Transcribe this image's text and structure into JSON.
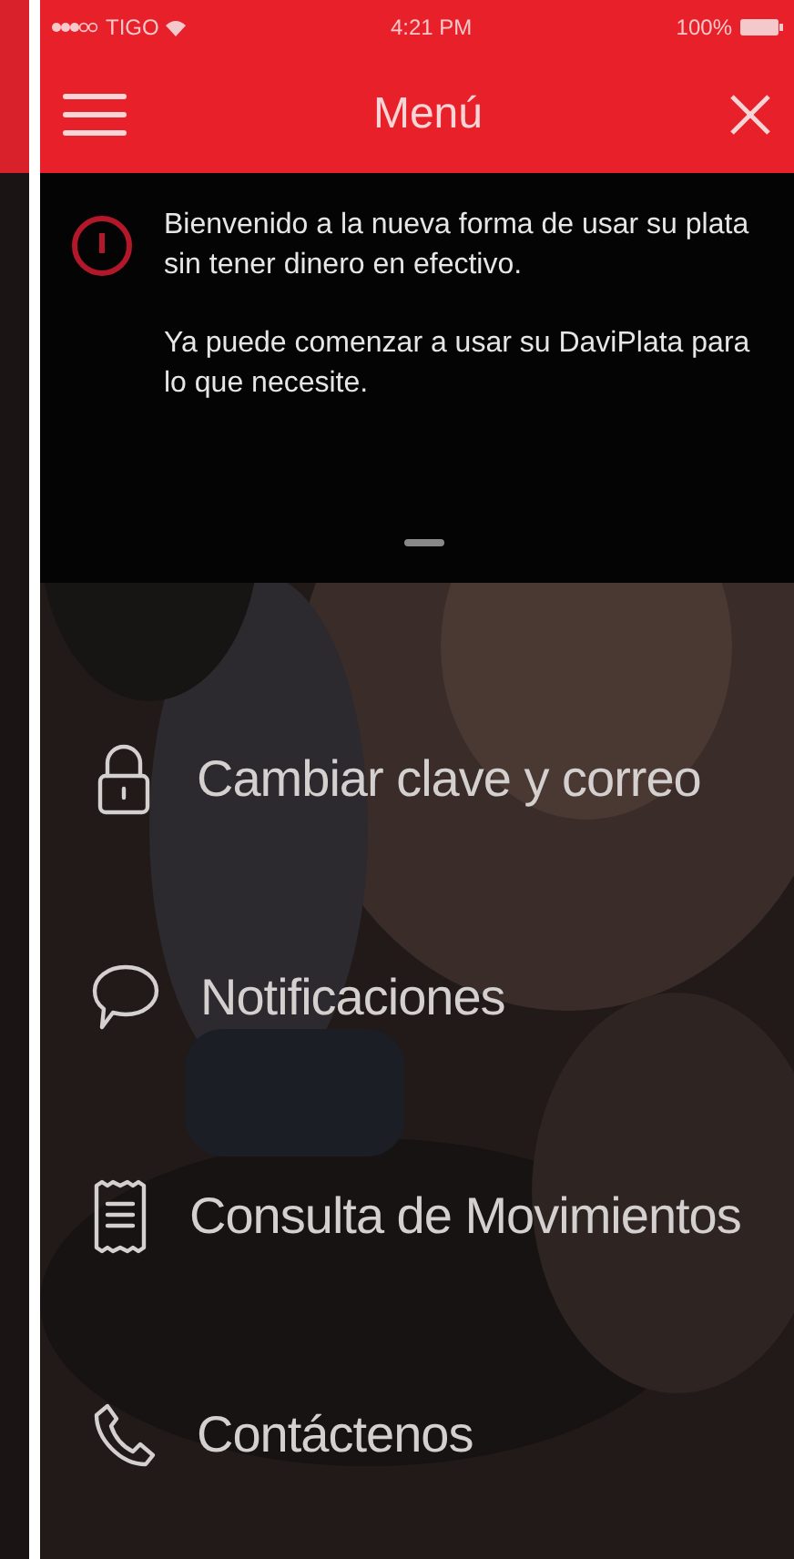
{
  "status_bar": {
    "carrier": "TIGO",
    "time": "4:21 PM",
    "battery": "100%"
  },
  "header": {
    "title": "Menú"
  },
  "welcome_overlay": {
    "paragraphs": [
      "Bienvenido a la nueva forma de usar su plata sin tener dinero en efectivo.",
      "Ya puede comenzar a usar su DaviPlata para lo que necesite."
    ]
  },
  "menu_items": [
    {
      "kind": "lock",
      "label": "Cambiar clave y correo"
    },
    {
      "kind": "chat",
      "label": "Notificaciones"
    },
    {
      "kind": "receipt",
      "label": "Consulta de Movimientos"
    },
    {
      "kind": "phone",
      "label": "Contáctenos"
    }
  ]
}
